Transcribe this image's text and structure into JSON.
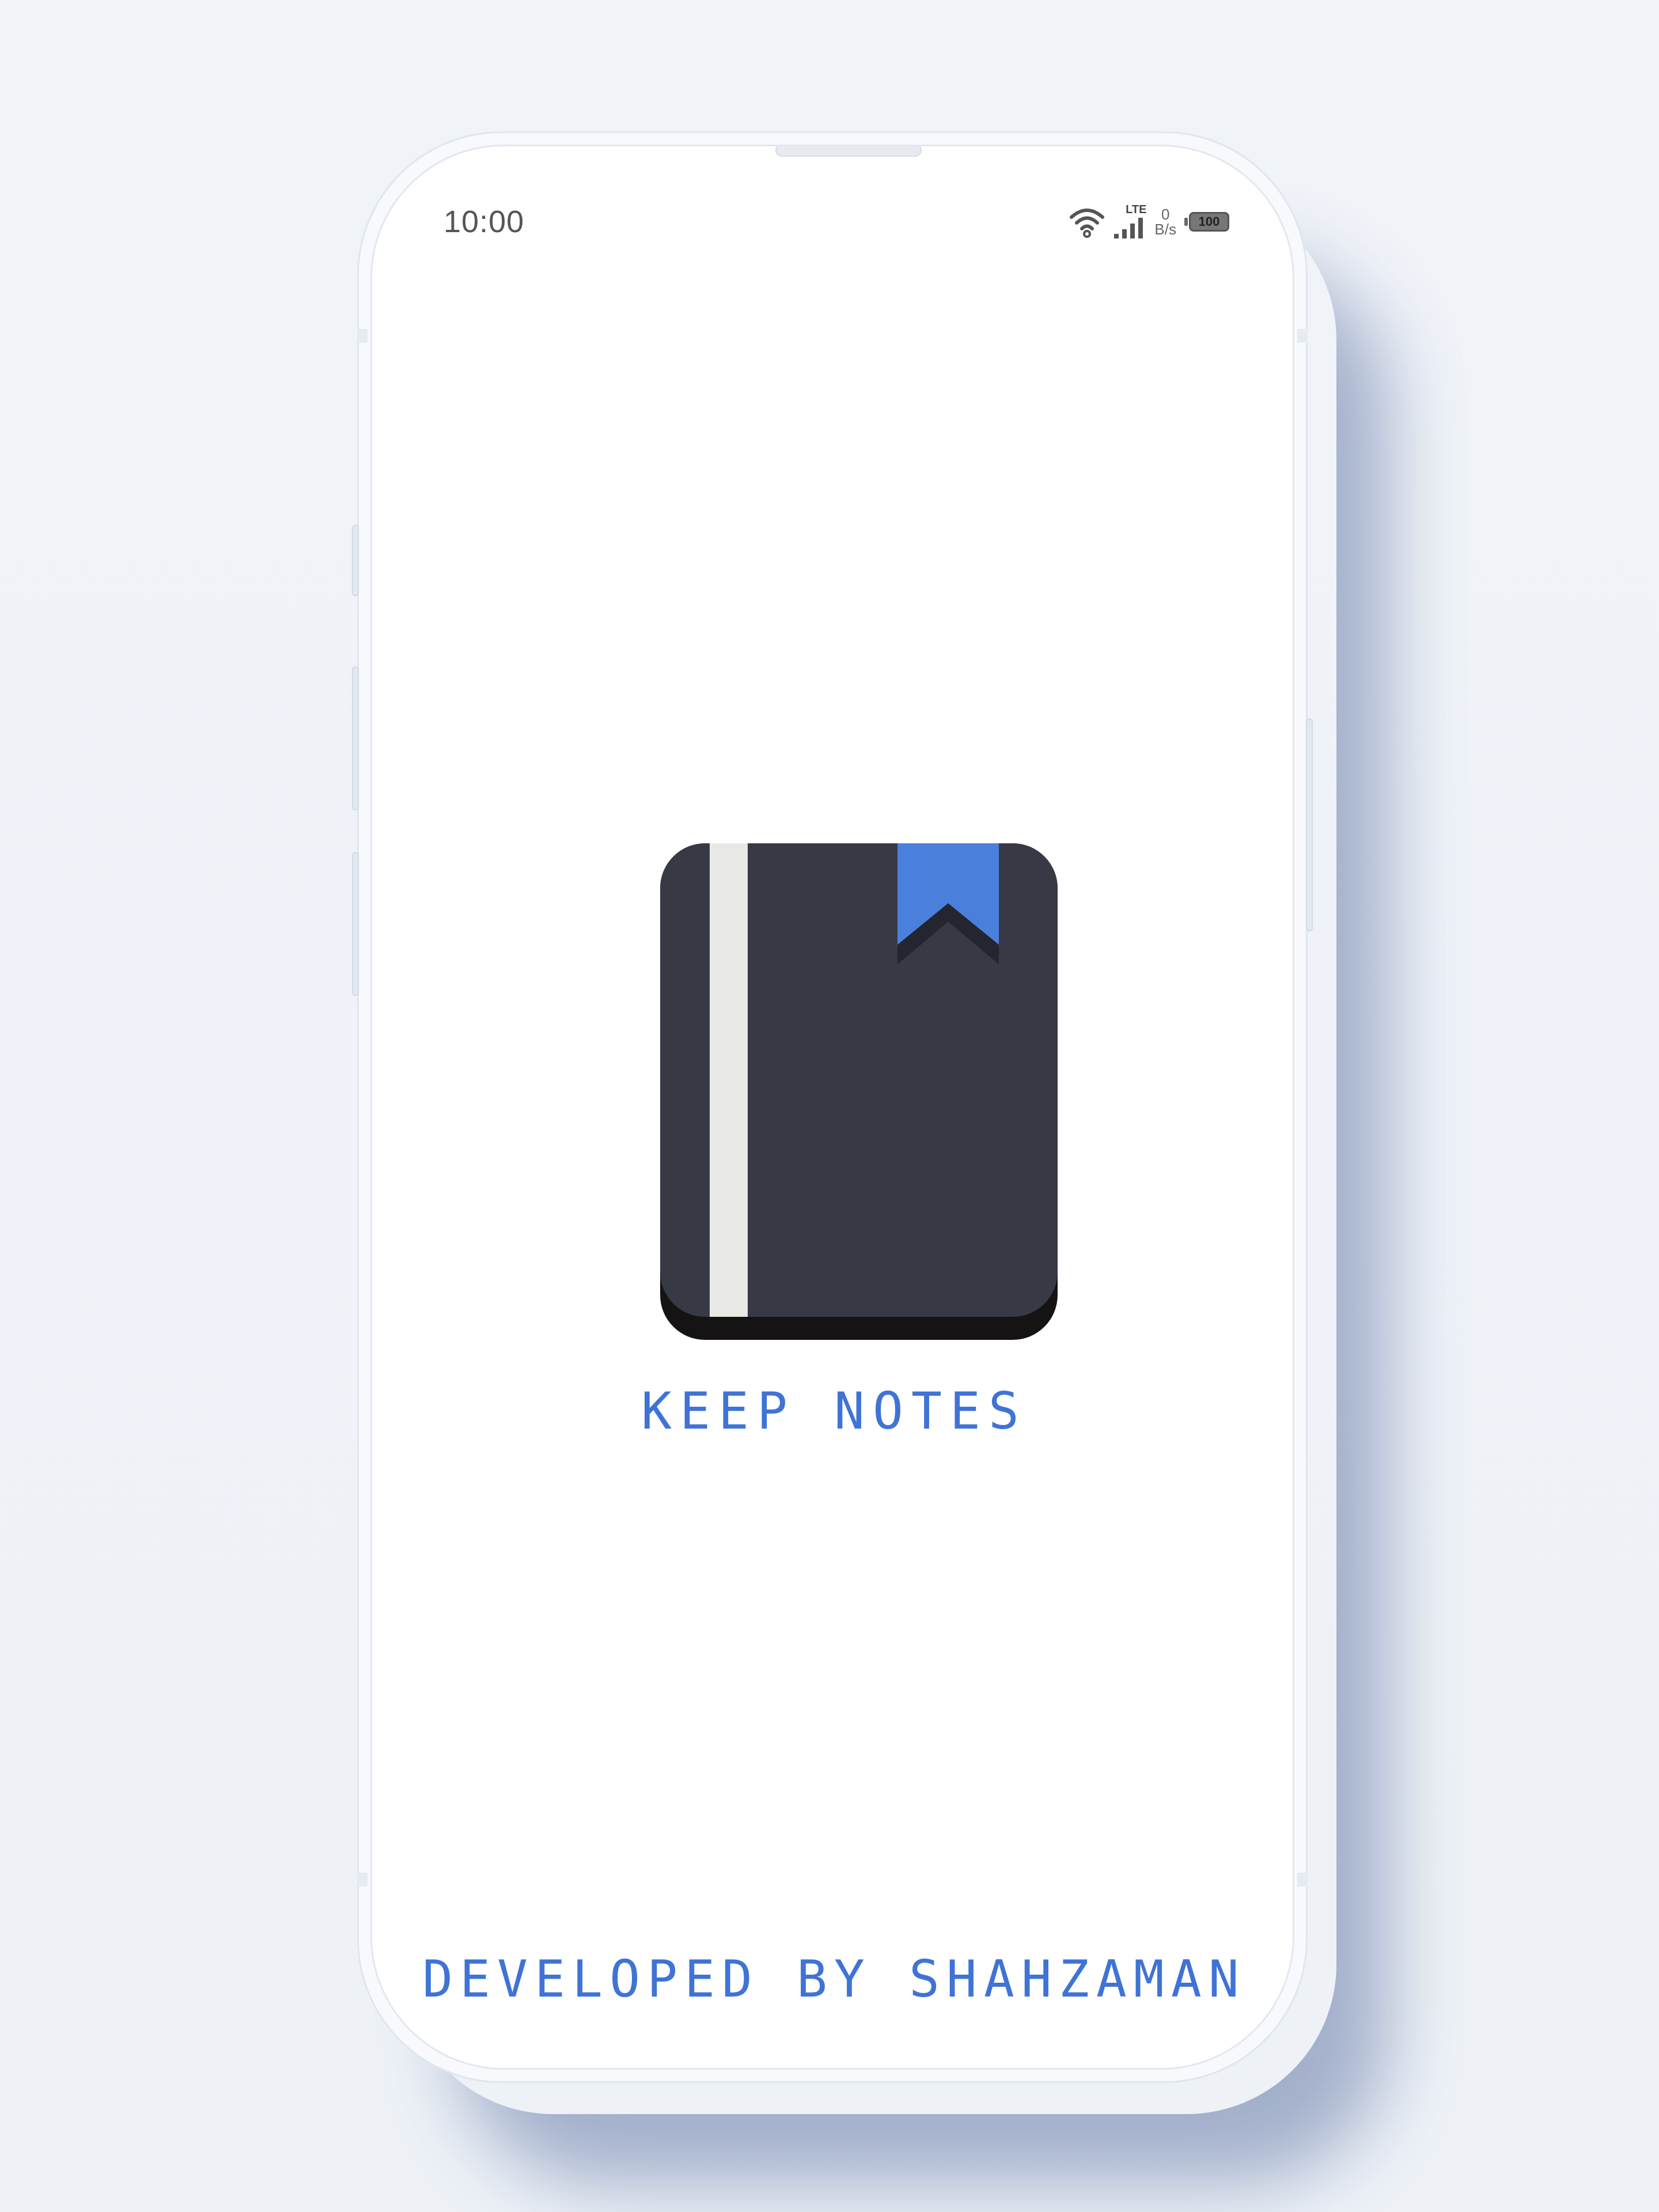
{
  "status_bar": {
    "time": "10:00",
    "network_type": "LTE",
    "speed_value": "0",
    "speed_unit": "B/s",
    "battery_level": "100"
  },
  "app": {
    "title": "KEEP NOTES",
    "credit": "DEVELOPED BY SHAHZAMAN"
  },
  "colors": {
    "accent": "#3f73d6",
    "book_cover": "#373945",
    "book_edge": "#151314",
    "bookmark": "#4a7fdc",
    "spine_band": "#e8e8e4",
    "background": "#eef2f7"
  },
  "icons": {
    "wifi": "wifi-icon",
    "signal": "signal-icon",
    "battery": "battery-icon",
    "logo": "notebook-icon"
  }
}
